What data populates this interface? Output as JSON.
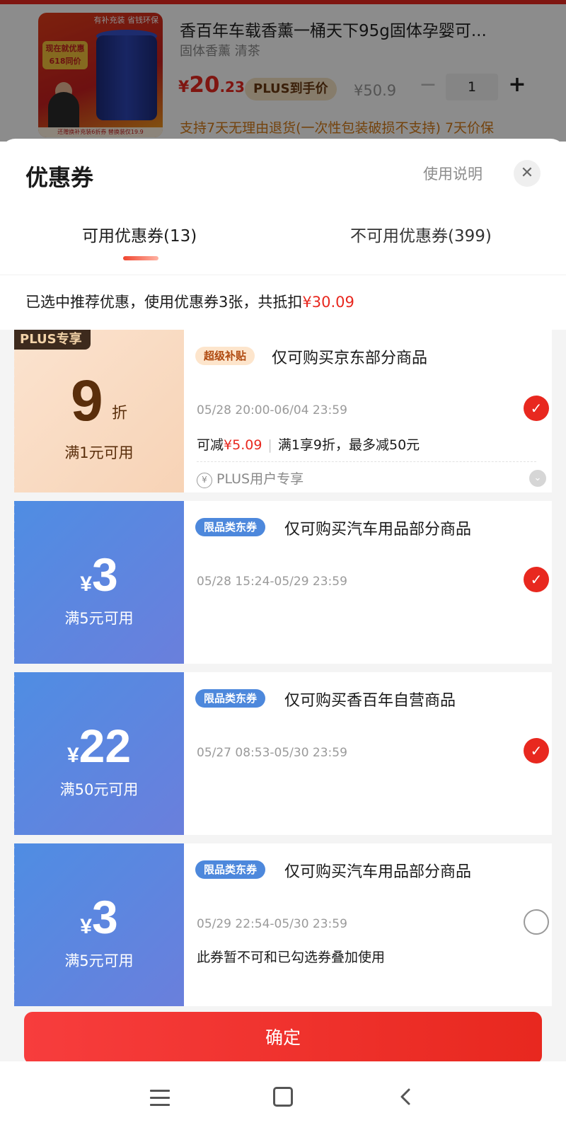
{
  "product": {
    "image_banner": "有补充装 省钱环保",
    "image_badge": "现在就优惠 618同价",
    "image_brand": "香百年",
    "image_footer": "还赠换补充装6折券 替换装仅19.9",
    "title": "香百年车载香薰一桶天下95g固体孕婴可...",
    "spec": "固体香薰 清茶",
    "price_yen": "¥",
    "price_int": "20",
    "price_dec": ".23",
    "plus_label": "PLUS到手价",
    "original_price": "¥50.9",
    "quantity": "1",
    "minus_glyph": "−",
    "plus_glyph": "+",
    "return_policy": "支持7天无理由退货(一次性包装破损不支持)  7天价保"
  },
  "sheet": {
    "title": "优惠券",
    "usage_link": "使用说明",
    "close_glyph": "✕",
    "tabs": [
      {
        "label": "可用优惠券(13)"
      },
      {
        "label": "不可用优惠券(399)"
      }
    ],
    "summary_prefix": "已选中推荐优惠，使用优惠券3张，共抵扣",
    "summary_amount": "¥30.09"
  },
  "coupons": [
    {
      "corner_tag": "PLUS专享",
      "discount": "9",
      "discount_unit": "折",
      "condition": "满1元可用",
      "tag": "超级补贴",
      "title": "仅可购买京东部分商品",
      "date": "05/28 20:00-06/04 23:59",
      "checked": true,
      "detail_prefix": "可减",
      "detail_amount": "¥5.09",
      "detail_sep": "|",
      "detail_rule": "满1享9折，最多减50元",
      "plus_user": "PLUS用户专享",
      "coin_glyph": "¥",
      "expand_glyph": "⌄"
    },
    {
      "yen": "¥",
      "amount": "3",
      "condition": "满5元可用",
      "tag": "限品类东券",
      "title": "仅可购买汽车用品部分商品",
      "date": "05/28 15:24-05/29 23:59",
      "checked": true
    },
    {
      "yen": "¥",
      "amount": "22",
      "condition": "满50元可用",
      "tag": "限品类东券",
      "title": "仅可购买香百年自营商品",
      "date": "05/27 08:53-05/30 23:59",
      "checked": true
    },
    {
      "yen": "¥",
      "amount": "3",
      "condition": "满5元可用",
      "tag": "限品类东券",
      "title": "仅可购买汽车用品部分商品",
      "date": "05/29 22:54-05/30 23:59",
      "checked": false,
      "note": "此券暂不可和已勾选券叠加使用"
    }
  ],
  "check_glyph": "✓",
  "confirm_label": "确定",
  "colors": {
    "accent_red": "#e8281f",
    "coupon_blue": "#4f8de3",
    "plus_gold": "#f7d3b6"
  }
}
